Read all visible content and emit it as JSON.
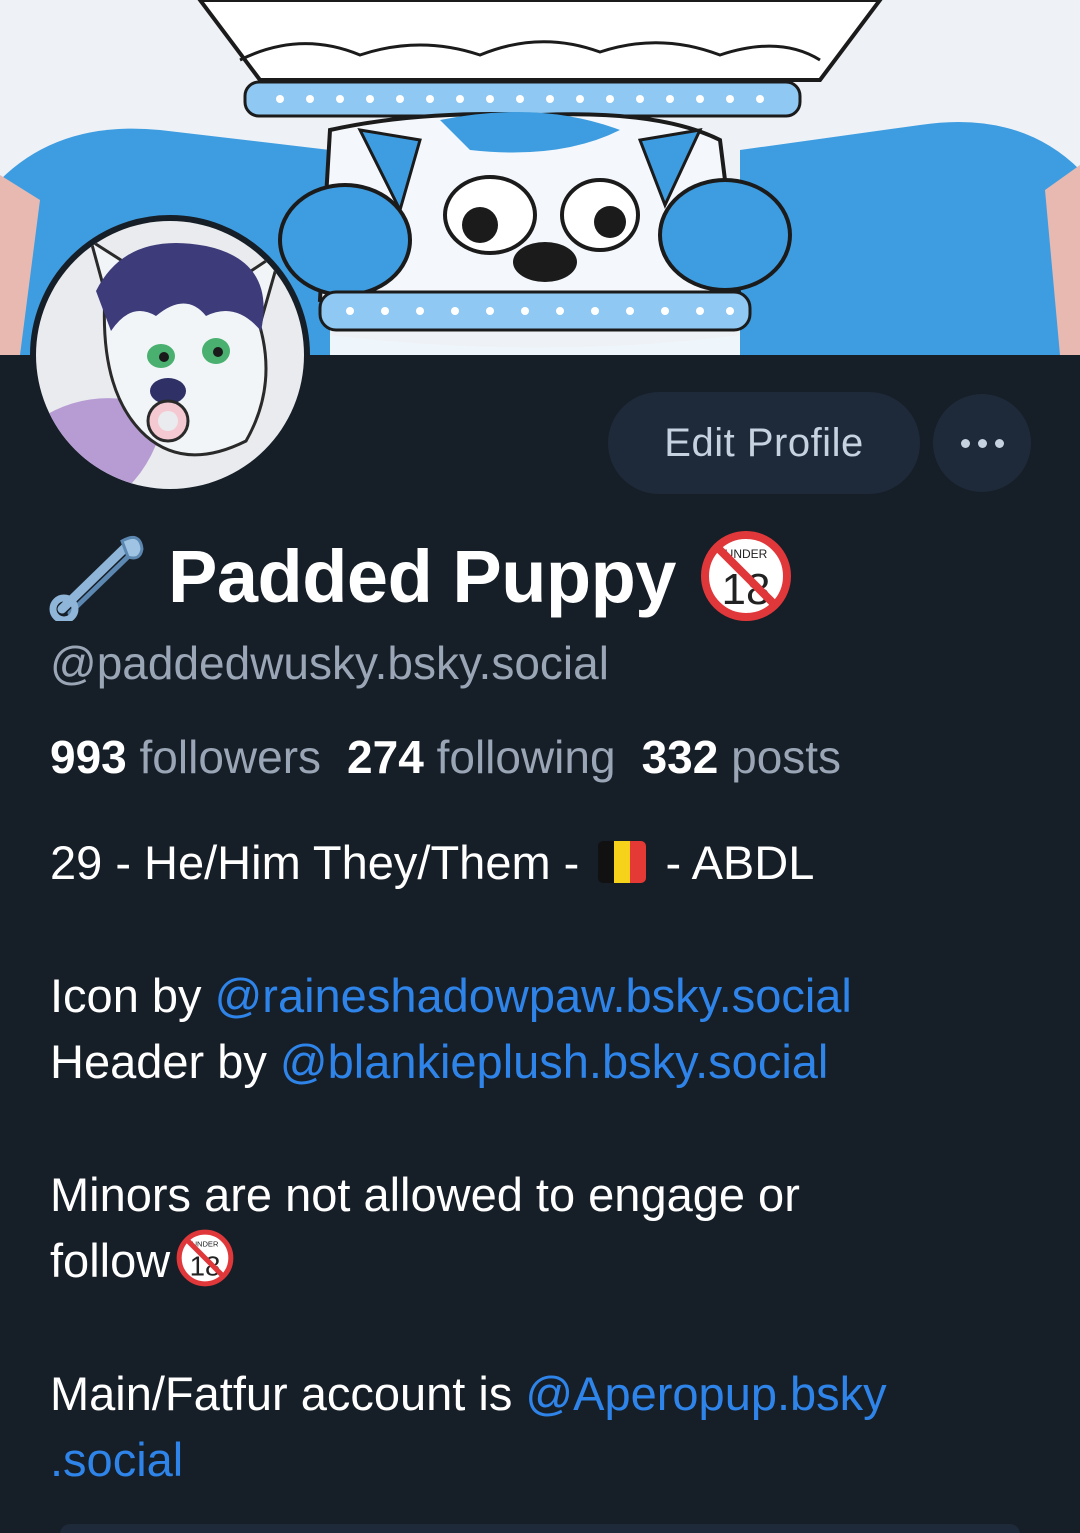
{
  "profile": {
    "display_name": "Padded Puppy",
    "handle": "@paddedwusky.bsky.social",
    "edit_label": "Edit Profile",
    "more_label": "•••",
    "badge_text": "UNDER",
    "badge_number": "18"
  },
  "stats": {
    "followers_count": "993",
    "followers_label": "followers",
    "following_count": "274",
    "following_label": "following",
    "posts_count": "332",
    "posts_label": "posts"
  },
  "bio": {
    "line1_prefix": "29 - He/Him They/Them - ",
    "line1_suffix": " - ABDL",
    "icon_prefix": "Icon by ",
    "icon_link": "@raineshadowpaw.bsky.social",
    "header_prefix": "Header by ",
    "header_link": "@blankieplush.bsky.social",
    "minors_line1": "Minors are not allowed to engage or",
    "minors_line2": "follow",
    "main_prefix": "Main/Fatfur account is ",
    "main_link_part1": "@Aperopup.bsky",
    "main_link_part2": ".social"
  },
  "colors": {
    "background": "#161e27",
    "link": "#2f84e9",
    "muted": "#9aa6b6",
    "button": "#1e2a3a"
  },
  "icons": {
    "pin": "safety-pin-icon",
    "under18": "no-under-18-icon",
    "flag": "belgium-flag-icon",
    "more": "more-options-icon"
  }
}
